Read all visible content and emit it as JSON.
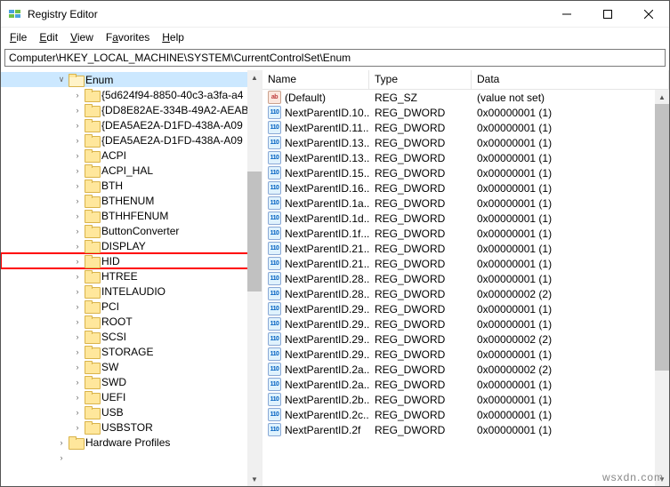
{
  "window": {
    "title": "Registry Editor"
  },
  "menu": {
    "file": "File",
    "edit": "Edit",
    "view": "View",
    "favorites": "Favorites",
    "help": "Help"
  },
  "address": "Computer\\HKEY_LOCAL_MACHINE\\SYSTEM\\CurrentControlSet\\Enum",
  "tree": {
    "root_label": "Enum",
    "items": [
      {
        "label": "{5d624f94-8850-40c3-a3fa-a4"
      },
      {
        "label": "{DD8E82AE-334B-49A2-AEAB"
      },
      {
        "label": "{DEA5AE2A-D1FD-438A-A09"
      },
      {
        "label": "{DEA5AE2A-D1FD-438A-A09"
      },
      {
        "label": "ACPI"
      },
      {
        "label": "ACPI_HAL"
      },
      {
        "label": "BTH"
      },
      {
        "label": "BTHENUM"
      },
      {
        "label": "BTHHFENUM"
      },
      {
        "label": "ButtonConverter"
      },
      {
        "label": "DISPLAY"
      },
      {
        "label": "HID",
        "highlight": true
      },
      {
        "label": "HTREE"
      },
      {
        "label": "INTELAUDIO"
      },
      {
        "label": "PCI"
      },
      {
        "label": "ROOT"
      },
      {
        "label": "SCSI"
      },
      {
        "label": "STORAGE"
      },
      {
        "label": "SW"
      },
      {
        "label": "SWD"
      },
      {
        "label": "UEFI"
      },
      {
        "label": "USB"
      },
      {
        "label": "USBSTOR"
      }
    ],
    "after_label": "Hardware Profiles"
  },
  "columns": {
    "name": "Name",
    "type": "Type",
    "data": "Data"
  },
  "values": [
    {
      "icon": "sz",
      "name": "(Default)",
      "type": "REG_SZ",
      "data": "(value not set)"
    },
    {
      "icon": "dw",
      "name": "NextParentID.10...",
      "type": "REG_DWORD",
      "data": "0x00000001 (1)"
    },
    {
      "icon": "dw",
      "name": "NextParentID.11...",
      "type": "REG_DWORD",
      "data": "0x00000001 (1)"
    },
    {
      "icon": "dw",
      "name": "NextParentID.13...",
      "type": "REG_DWORD",
      "data": "0x00000001 (1)"
    },
    {
      "icon": "dw",
      "name": "NextParentID.13...",
      "type": "REG_DWORD",
      "data": "0x00000001 (1)"
    },
    {
      "icon": "dw",
      "name": "NextParentID.15...",
      "type": "REG_DWORD",
      "data": "0x00000001 (1)"
    },
    {
      "icon": "dw",
      "name": "NextParentID.16...",
      "type": "REG_DWORD",
      "data": "0x00000001 (1)"
    },
    {
      "icon": "dw",
      "name": "NextParentID.1a...",
      "type": "REG_DWORD",
      "data": "0x00000001 (1)"
    },
    {
      "icon": "dw",
      "name": "NextParentID.1d...",
      "type": "REG_DWORD",
      "data": "0x00000001 (1)"
    },
    {
      "icon": "dw",
      "name": "NextParentID.1f...",
      "type": "REG_DWORD",
      "data": "0x00000001 (1)"
    },
    {
      "icon": "dw",
      "name": "NextParentID.21...",
      "type": "REG_DWORD",
      "data": "0x00000001 (1)"
    },
    {
      "icon": "dw",
      "name": "NextParentID.21...",
      "type": "REG_DWORD",
      "data": "0x00000001 (1)"
    },
    {
      "icon": "dw",
      "name": "NextParentID.28...",
      "type": "REG_DWORD",
      "data": "0x00000001 (1)"
    },
    {
      "icon": "dw",
      "name": "NextParentID.28...",
      "type": "REG_DWORD",
      "data": "0x00000002 (2)"
    },
    {
      "icon": "dw",
      "name": "NextParentID.29...",
      "type": "REG_DWORD",
      "data": "0x00000001 (1)"
    },
    {
      "icon": "dw",
      "name": "NextParentID.29...",
      "type": "REG_DWORD",
      "data": "0x00000001 (1)"
    },
    {
      "icon": "dw",
      "name": "NextParentID.29...",
      "type": "REG_DWORD",
      "data": "0x00000002 (2)"
    },
    {
      "icon": "dw",
      "name": "NextParentID.29...",
      "type": "REG_DWORD",
      "data": "0x00000001 (1)"
    },
    {
      "icon": "dw",
      "name": "NextParentID.2a...",
      "type": "REG_DWORD",
      "data": "0x00000002 (2)"
    },
    {
      "icon": "dw",
      "name": "NextParentID.2a...",
      "type": "REG_DWORD",
      "data": "0x00000001 (1)"
    },
    {
      "icon": "dw",
      "name": "NextParentID.2b...",
      "type": "REG_DWORD",
      "data": "0x00000001 (1)"
    },
    {
      "icon": "dw",
      "name": "NextParentID.2c...",
      "type": "REG_DWORD",
      "data": "0x00000001 (1)"
    },
    {
      "icon": "dw",
      "name": "NextParentID.2f",
      "type": "REG_DWORD",
      "data": "0x00000001 (1)"
    }
  ],
  "watermark": "wsxdn.com"
}
